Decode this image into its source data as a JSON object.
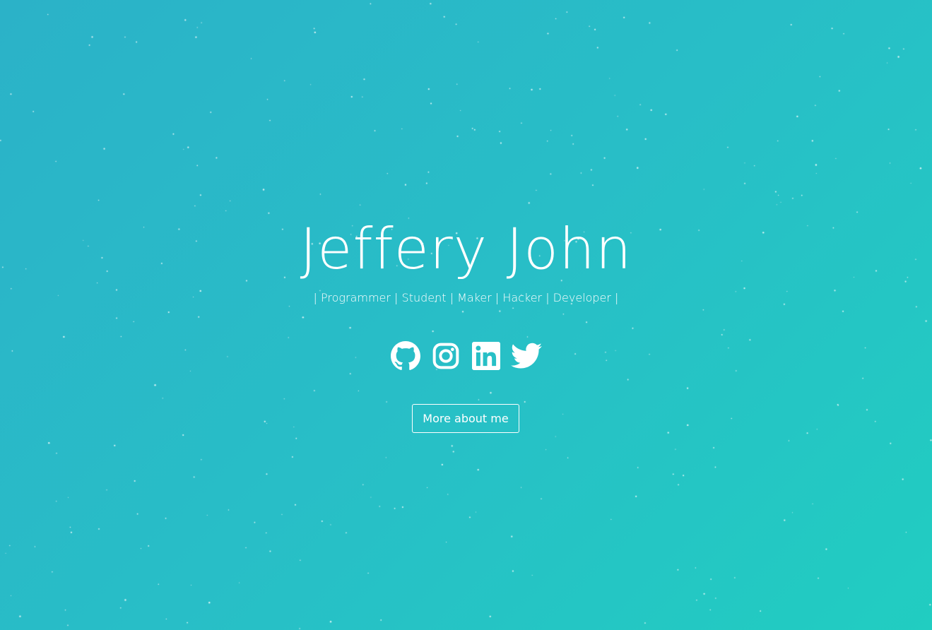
{
  "hero": {
    "name": "Jeffery John",
    "tagline": "| Programmer | Student | Maker | Hacker | Developer |",
    "more_button_label": "More about me"
  },
  "social": [
    {
      "icon": "github-icon",
      "label": "GitHub"
    },
    {
      "icon": "instagram-icon",
      "label": "Instagram"
    },
    {
      "icon": "linkedin-icon",
      "label": "LinkedIn"
    },
    {
      "icon": "twitter-icon",
      "label": "Twitter"
    }
  ],
  "colors": {
    "gradient_start": "#2bb2c8",
    "gradient_end": "#21cdc1",
    "foreground": "#ffffff"
  }
}
